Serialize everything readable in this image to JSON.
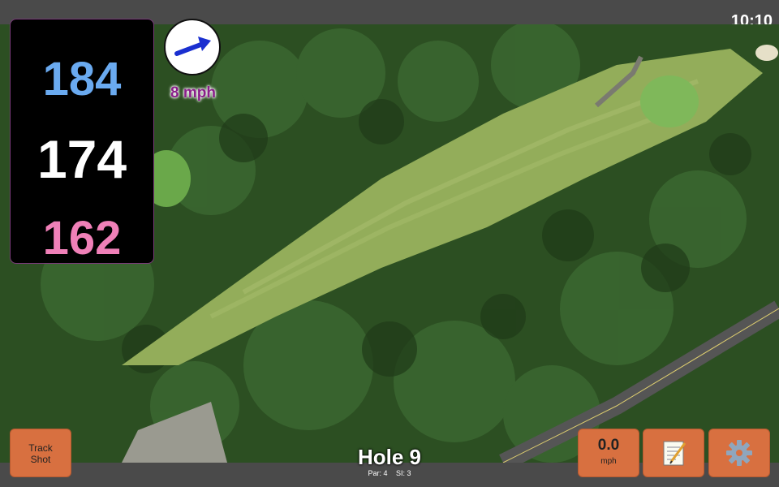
{
  "status": {
    "time": "10:10"
  },
  "distances": {
    "back": "184",
    "center": "174",
    "front": "162"
  },
  "wind": {
    "speed": "8 mph",
    "direction_icon": "arrow-east-icon"
  },
  "buttons": {
    "track_shot": {
      "line1": "Track",
      "line2": "Shot"
    },
    "speed": {
      "value": "0.0",
      "unit": "mph"
    },
    "notes_icon": "notepad-icon",
    "settings_icon": "gear-icon"
  },
  "hole": {
    "title": "Hole 9",
    "par": "Par: 4",
    "si": "SI: 3"
  },
  "colors": {
    "back_distance": "#6aaaf0",
    "center_distance": "#ffffff",
    "front_distance": "#f080b8",
    "button_bg": "#d87040",
    "wind_text": "#8a1f8a"
  }
}
